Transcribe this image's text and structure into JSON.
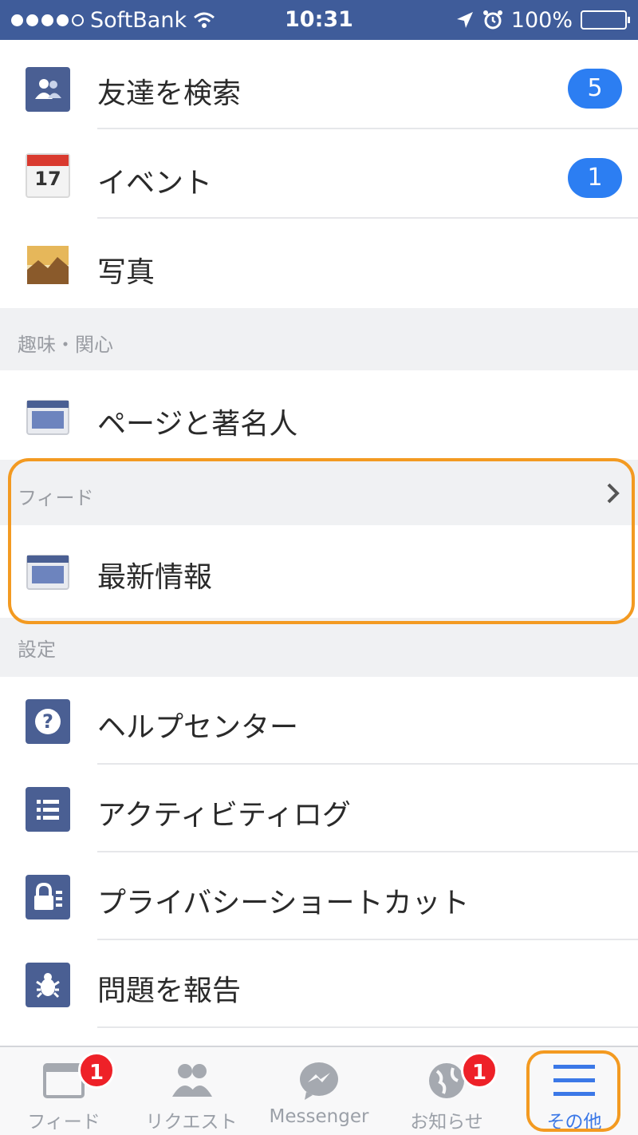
{
  "status_bar": {
    "carrier": "SoftBank",
    "time": "10:31",
    "battery": "100%"
  },
  "menu": {
    "find_friends": {
      "label": "友達を検索",
      "badge": "5"
    },
    "events": {
      "label": "イベント",
      "badge": "1",
      "calendar_day": "17"
    },
    "photos": {
      "label": "写真"
    },
    "interests_section": "趣味・関心",
    "pages": {
      "label": "ページと著名人"
    },
    "feed_section": "フィード",
    "most_recent": {
      "label": "最新情報"
    },
    "settings_section": "設定",
    "help_center": {
      "label": "ヘルプセンター"
    },
    "activity_log": {
      "label": "アクティビティログ"
    },
    "privacy_shortcuts": {
      "label": "プライバシーショートカット"
    },
    "report_problem": {
      "label": "問題を報告"
    }
  },
  "tab_bar": {
    "feed": {
      "label": "フィード",
      "badge": "1"
    },
    "requests": {
      "label": "リクエスト"
    },
    "messenger": {
      "label": "Messenger"
    },
    "notifications": {
      "label": "お知らせ",
      "badge": "1"
    },
    "more": {
      "label": "その他",
      "active": true
    }
  },
  "colors": {
    "status_bar": "#3f5c9a",
    "badge_blue": "#2c7ef2",
    "highlight_orange": "#f39a21",
    "tab_active": "#3b78e7",
    "tab_badge_red": "#ee2128"
  }
}
